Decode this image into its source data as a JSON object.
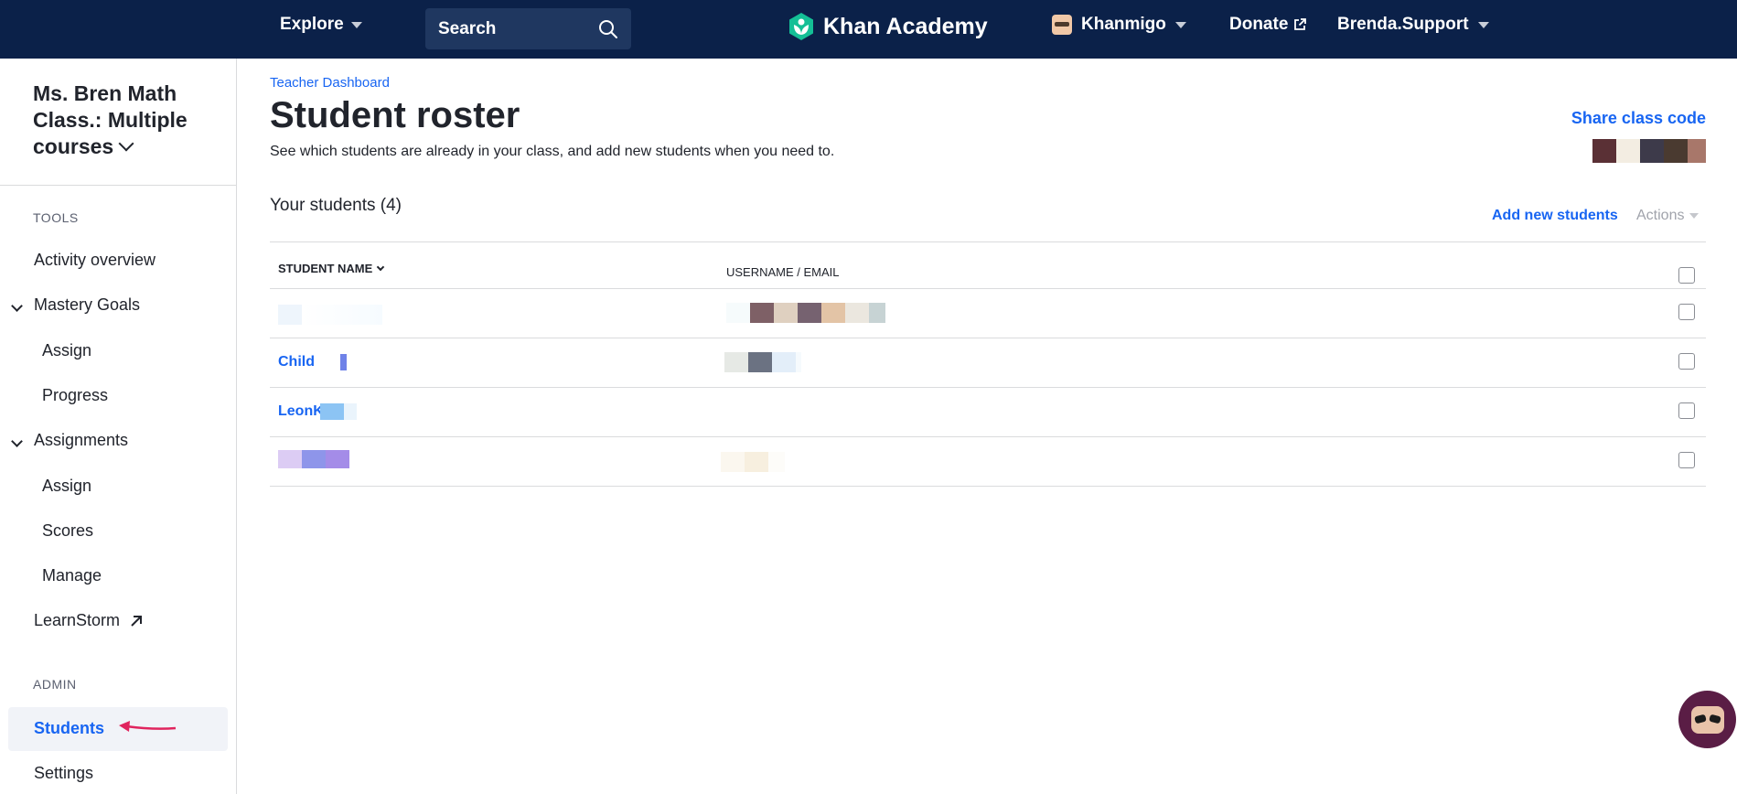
{
  "topnav": {
    "explore_label": "Explore",
    "search_placeholder": "Search",
    "logo_text": "Khan Academy",
    "khanmigo_label": "Khanmigo",
    "donate_label": "Donate",
    "user_label": "Brenda.Support",
    "background_color": "#0b2149"
  },
  "sidebar": {
    "class_title": "Ms. Bren Math Class.: Multiple courses",
    "tools_label": "TOOLS",
    "activity_overview": "Activity overview",
    "mastery_goals": "Mastery Goals",
    "mastery_assign": "Assign",
    "mastery_progress": "Progress",
    "assignments": "Assignments",
    "assignments_assign": "Assign",
    "assignments_scores": "Scores",
    "assignments_manage": "Manage",
    "learnstorm": "LearnStorm",
    "admin_label": "ADMIN",
    "students": "Students",
    "settings": "Settings",
    "active_item": "Students"
  },
  "main": {
    "breadcrumb": "Teacher Dashboard",
    "title": "Student roster",
    "description": "See which students are already in your class, and add new students when you need to.",
    "share_class_code": "Share class code",
    "students_heading": "Your students (4)",
    "add_new_students": "Add new students",
    "actions_label": "Actions",
    "table": {
      "columns": [
        "STUDENT NAME",
        "USERNAME / EMAIL"
      ],
      "rows": [
        {
          "name": "",
          "username": ""
        },
        {
          "name": "Child",
          "username": ""
        },
        {
          "name": "LeonK",
          "username": ""
        },
        {
          "name": "",
          "username": ""
        }
      ]
    }
  },
  "colors": {
    "accent": "#1865f2",
    "text": "#21242c",
    "annotation_arrow": "#e0245e"
  }
}
